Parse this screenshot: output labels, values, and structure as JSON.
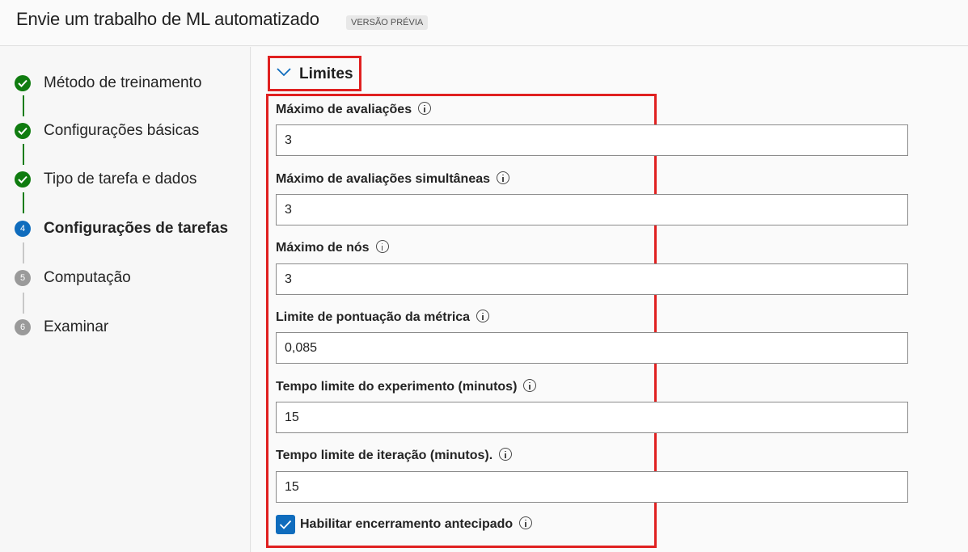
{
  "header": {
    "title": "Envie um trabalho de ML automatizado",
    "badge": "VERSÃO PRÉVIA"
  },
  "steps": [
    {
      "label": "Método de treinamento",
      "status": "done",
      "marker": ""
    },
    {
      "label": "Configurações básicas",
      "status": "done",
      "marker": ""
    },
    {
      "label": "Tipo de tarefa e dados",
      "status": "done",
      "marker": ""
    },
    {
      "label": "Configurações de tarefas",
      "status": "current",
      "marker": "4"
    },
    {
      "label": "Computação",
      "status": "pending",
      "marker": "5"
    },
    {
      "label": "Examinar",
      "status": "pending",
      "marker": "6"
    }
  ],
  "section": {
    "title": "Limites"
  },
  "fields": [
    {
      "label": "Máximo de avaliações",
      "value": "3"
    },
    {
      "label": "Máximo de avaliações simultâneas",
      "value": "3"
    },
    {
      "label": "Máximo de nós",
      "value": "3"
    },
    {
      "label": "Limite de pontuação da métrica",
      "value": "0,085"
    },
    {
      "label": "Tempo limite do experimento (minutos)",
      "value": "15"
    },
    {
      "label": "Tempo limite de iteração (minutos).",
      "value": "15"
    }
  ],
  "early_termination": {
    "label": "Habilitar encerramento antecipado",
    "checked": true
  },
  "colors": {
    "done": "#107c10",
    "current": "#0f6cbd",
    "pending": "#9a9a9a",
    "highlight": "#e02020"
  }
}
